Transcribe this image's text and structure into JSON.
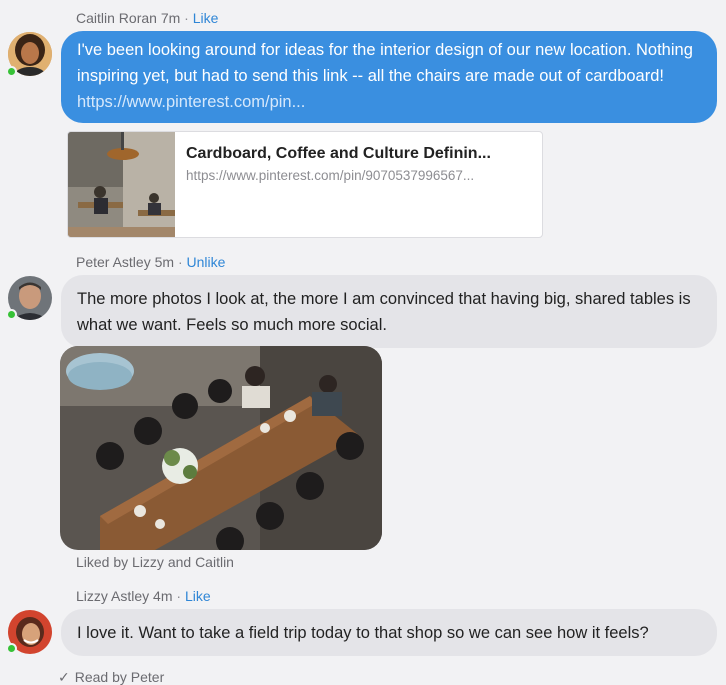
{
  "messages": [
    {
      "author": "Caitlin Roran",
      "time": "7m",
      "separator": "·",
      "action": "Like",
      "text": "I've been looking around for ideas for the interior design of our new location. Nothing inspiring yet, but had to send this link -- all the chairs are made out of cardboard! ",
      "link_text": "https://www.pinterest.com/pin...",
      "link_preview": {
        "title": "Cardboard, Coffee and Culture Definin...",
        "url": "https://www.pinterest.com/pin/9070537996567..."
      },
      "presence": "online"
    },
    {
      "author": "Peter Astley",
      "time": "5m",
      "separator": "·",
      "action": "Unlike",
      "text": "The more photos I look at, the more I am convinced that having big, shared tables is what we want. Feels so much more social.",
      "image": "cafe-shared-table-photo",
      "liked_by": "Liked by Lizzy and Caitlin",
      "presence": "online"
    },
    {
      "author": "Lizzy Astley",
      "time": "4m",
      "separator": "·",
      "action": "Like",
      "text": "I love it. Want to take a field trip today to that shop so we can see how it feels?",
      "presence": "online"
    }
  ],
  "read_receipt": {
    "icon": "checkmark-icon",
    "text": "Read by Peter"
  },
  "colors": {
    "outgoing_bubble": "#3a8fe0",
    "incoming_bubble": "#e4e4e8",
    "action_link": "#2f86d6",
    "presence": "#37c237",
    "background": "#f2f2f4"
  }
}
